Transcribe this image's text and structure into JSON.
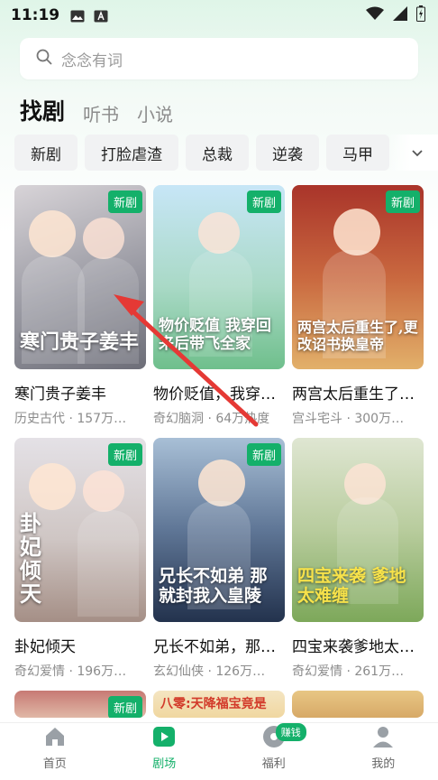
{
  "status_bar": {
    "time": "11:19"
  },
  "search": {
    "placeholder": "念念有词"
  },
  "main_tabs": [
    {
      "label": "找剧",
      "active": true
    },
    {
      "label": "听书",
      "active": false
    },
    {
      "label": "小说",
      "active": false
    }
  ],
  "chips": [
    "新剧",
    "打脸虐渣",
    "总裁",
    "逆袭",
    "马甲"
  ],
  "badge_label": "新剧",
  "cards": [
    {
      "title": "寒门贵子姜丰",
      "meta": "历史古代 · 157万…",
      "poster_text": "寒门贵子姜丰",
      "colors": [
        "#c9c5c9",
        "#7a7b84"
      ]
    },
    {
      "title": "物价贬值，我穿…",
      "meta": "奇幻脑洞 · 64万热度",
      "poster_text": "物价贬值 我穿回来后带飞全家",
      "colors": [
        "#bfe0f4",
        "#7ac59a"
      ]
    },
    {
      "title": "两宫太后重生了…",
      "meta": "宫斗宅斗 · 300万…",
      "poster_text": "两宫太后重生了,更改诏书换皇帝",
      "colors": [
        "#b73a2c",
        "#d9a05a"
      ]
    },
    {
      "title": "卦妃倾天",
      "meta": "奇幻爱情 · 196万…",
      "poster_text": "卦妃倾天",
      "colors": [
        "#dcd9e0",
        "#b7a9a3"
      ]
    },
    {
      "title": "兄长不如弟，那…",
      "meta": "玄幻仙侠 · 126万…",
      "poster_text": "兄长不如弟 那就封我入皇陵",
      "colors": [
        "#9ab0c8",
        "#2d3f5e"
      ]
    },
    {
      "title": "四宝来袭爹地太…",
      "meta": "奇幻爱情 · 261万…",
      "poster_text": "四宝来袭 爹地太难缠",
      "colors": [
        "#d4ddc6",
        "#8fb26c"
      ]
    }
  ],
  "partial_cards": [
    {
      "badge": "新剧",
      "colors": [
        "#c77a74",
        "#e0b7a6"
      ],
      "poster_text": ""
    },
    {
      "badge": "",
      "colors": [
        "#f4e5c2",
        "#f0d7a0"
      ],
      "poster_text": "八零:天降福宝竟是"
    },
    {
      "badge": "",
      "colors": [
        "#e8c785",
        "#d7a966"
      ],
      "poster_text": ""
    }
  ],
  "bottom_nav": [
    {
      "label": "首页",
      "icon": "home-icon",
      "active": false
    },
    {
      "label": "剧场",
      "icon": "theater-icon",
      "active": true
    },
    {
      "label": "福利",
      "icon": "welfare-icon",
      "active": false,
      "badge": "赚钱"
    },
    {
      "label": "我的",
      "icon": "profile-icon",
      "active": false
    }
  ],
  "colors": {
    "accent": "#14b06a",
    "arrow": "#e53935"
  }
}
